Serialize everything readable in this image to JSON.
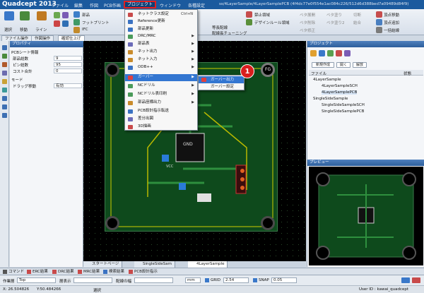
{
  "app": {
    "title": "Quadcept 2013"
  },
  "menu": {
    "file": "ファイル",
    "edit": "編集",
    "create": "作図",
    "pcb_create": "PCB作画",
    "project": "プロジェクト",
    "window": "ウィンドウ",
    "settings": "各種設定"
  },
  "doc_path": "ss/4LayerSample/4LayerSamplePCB (4f4dc77e0f554e1ac084c226/512d6d388bed7a09489d84f9)",
  "ribbon": {
    "select": "選択",
    "move": "移動",
    "line": "ライン",
    "parts": "部品",
    "footprint": "フットプリント",
    "ifc": "IFC",
    "forbid_area": "禁止領域",
    "design_rule_area": "デザインルール領域",
    "area_tuning": "配線長チューニング",
    "same_length": "等長配線",
    "via_arrange": "ベタ展開",
    "via_dot": "ベタ削除",
    "via_mod": "ベタ修正",
    "via_fill": "ベタ塗り",
    "via_hatch": "ベタ塗り2",
    "cut": "切断",
    "merge": "結合",
    "join_all": "一括結線",
    "vertex_move": "頂点移動",
    "vertex_add": "頂点追加",
    "vertex_delete": "頂点削除"
  },
  "tabs": {
    "file_op": "ファイル操作",
    "design_op": "作図操作",
    "confirm": "確認仕上げ"
  },
  "properties": {
    "header": "プロパティ",
    "sheet_section": "PCBシート情報",
    "rows": [
      {
        "label": "部品総数",
        "value": "9"
      },
      {
        "label": "ピン総数",
        "value": "95"
      },
      {
        "label": "コスト合計",
        "value": "0"
      }
    ],
    "mode_section": "モード",
    "drag_label": "ドラッグ移動",
    "drag_value": "有効"
  },
  "project_menu": {
    "items": [
      {
        "label": "ネットクラス設定",
        "shortcut": "Ctrl+N",
        "arrow": false
      },
      {
        "label": "Reference更新",
        "shortcut": "",
        "arrow": false
      },
      {
        "label": "部品更新",
        "shortcut": "",
        "arrow": false
      },
      {
        "label": "DRC/MRC",
        "shortcut": "",
        "arrow": true
      },
      {
        "label": "部品表",
        "shortcut": "",
        "arrow": true
      },
      {
        "label": "ネット出力",
        "shortcut": "",
        "arrow": true
      },
      {
        "label": "ネット入力",
        "shortcut": "",
        "arrow": true
      },
      {
        "label": "ODB++",
        "shortcut": "",
        "arrow": true
      },
      {
        "label": "ガーバー",
        "shortcut": "",
        "arrow": true
      },
      {
        "label": "NCドリル",
        "shortcut": "",
        "arrow": true
      },
      {
        "label": "NCドリル表印刷",
        "shortcut": "",
        "arrow": true
      },
      {
        "label": "部品座標出力",
        "shortcut": "",
        "arrow": true
      },
      {
        "label": "PCB設計指示転送",
        "shortcut": "",
        "arrow": false
      },
      {
        "label": "差分出図",
        "shortcut": "",
        "arrow": false
      },
      {
        "label": "3D描画",
        "shortcut": "",
        "arrow": false
      }
    ]
  },
  "gerber_submenu": {
    "output": "ガーバー出力",
    "settings": "ガーバー設定"
  },
  "badge": "1",
  "project_panel": {
    "header": "プロジェクト",
    "new_btn": "新規作成",
    "open_btn": "開く",
    "close_btn": "解放",
    "col_file": "ファイル",
    "col_status": "状態",
    "tree": [
      {
        "label": "4LayerSample",
        "level": 0
      },
      {
        "label": "4LayerSampleSCH",
        "level": 1
      },
      {
        "label": "4LayerSamplePCB",
        "level": 1
      },
      {
        "label": "SingleSideSample",
        "level": 0
      },
      {
        "label": "SingleSideSampleSCH",
        "level": 1
      },
      {
        "label": "SingleSideSamplePCB",
        "level": 1
      }
    ]
  },
  "preview": {
    "header": "プレビュー"
  },
  "doc_tabs": [
    "スタートページ",
    "SingleSideSam",
    "4LayerSample"
  ],
  "bottom_tabs": [
    "コマンド",
    "ERC結果",
    "DRC結果",
    "MRC結果",
    "検索結果",
    "PCB設計指示"
  ],
  "status": {
    "layer_label": "作業層",
    "layer_value": "Top",
    "layer_mode_label": "層表示",
    "layer_mode_value": "",
    "route_label": "配線の幅",
    "route_value": "",
    "unit": "mm",
    "grid_label": "GRID",
    "grid_value": "2.54",
    "snap_label": "SNAP",
    "snap_value": "0.05"
  },
  "coords": {
    "x": "X: 26.504826",
    "y": "Y:50.484266",
    "select": "選択",
    "user": "User ID : kawai_quadcept"
  },
  "board": {
    "fg_label": "FG",
    "gnd_label": "GND",
    "vcc_label": "VCC"
  }
}
